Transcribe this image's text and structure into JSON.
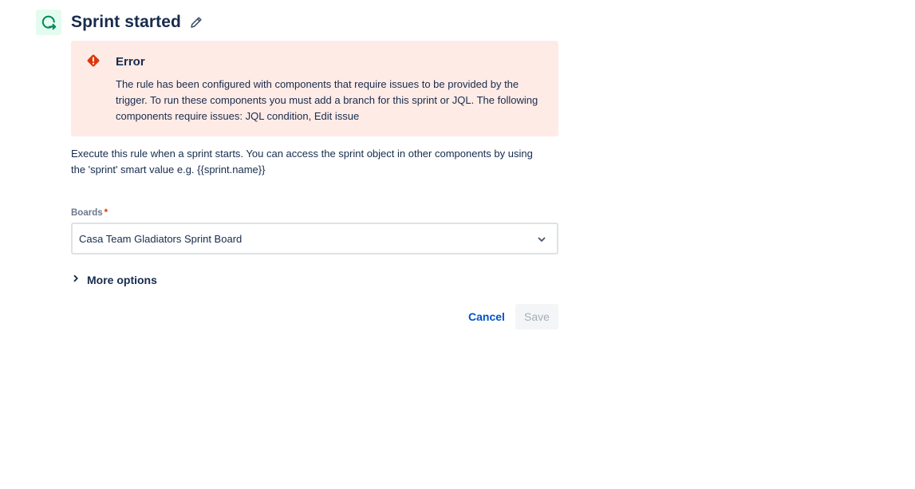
{
  "header": {
    "icon": "sprint-trigger-icon",
    "title": "Sprint started",
    "edit_icon": "pencil-icon"
  },
  "error": {
    "icon": "error-icon",
    "title": "Error",
    "message": "The rule has been configured with components that require issues to be provided by the trigger. To run these components you must add a branch for this sprint or JQL. The following components require issues: JQL condition, Edit issue"
  },
  "description": "Execute this rule when a sprint starts. You can access the sprint object in other components by using the 'sprint' smart value e.g. {{sprint.name}}",
  "boards": {
    "label": "Boards",
    "required_marker": "*",
    "selected_value": "Casa Team Gladiators Sprint Board",
    "chevron_icon": "chevron-down-icon"
  },
  "more_options": {
    "label": "More options",
    "icon": "chevron-right-icon"
  },
  "actions": {
    "cancel_label": "Cancel",
    "save_label": "Save"
  },
  "colors": {
    "error_background": "#ffebe6",
    "error_icon": "#de350b",
    "trigger_icon_background": "#e3fcef",
    "trigger_icon": "#00875a",
    "link": "#0052cc",
    "disabled_button_bg": "#f4f5f7",
    "disabled_button_text": "#a5adba"
  }
}
